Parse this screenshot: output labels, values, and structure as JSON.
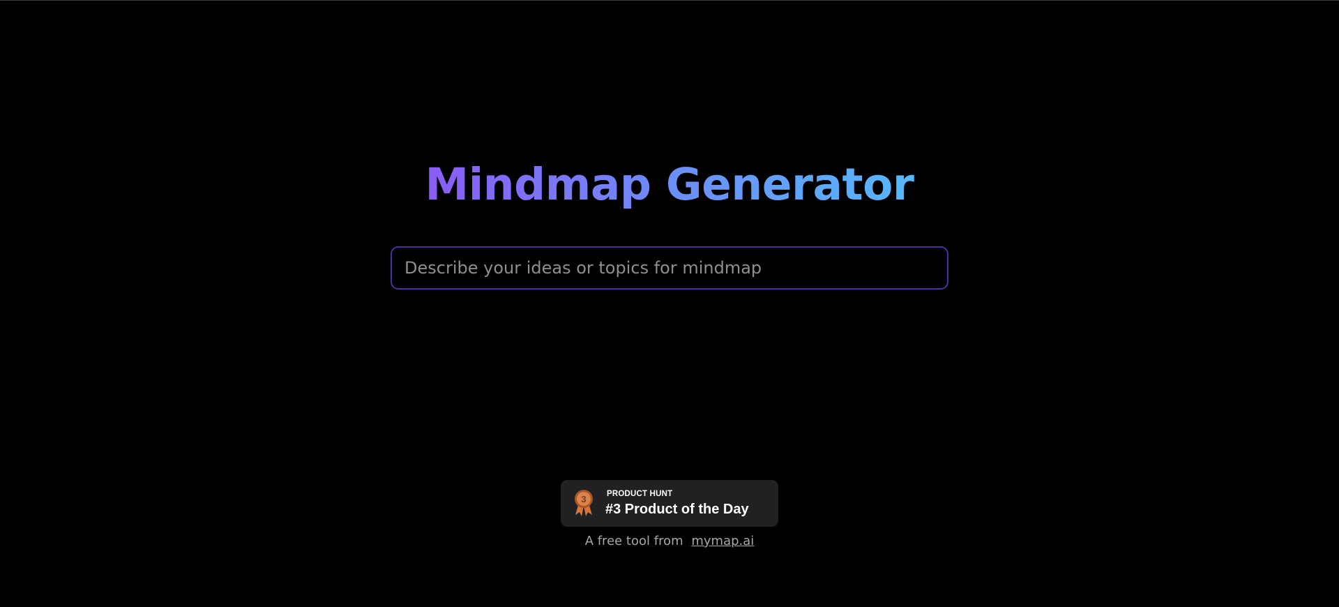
{
  "hero": {
    "title": "Mindmap Generator"
  },
  "search": {
    "value": "",
    "placeholder": "Describe your ideas or topics for mindmap"
  },
  "badge": {
    "label": "PRODUCT HUNT",
    "title": "#3 Product of the Day",
    "rank": "3",
    "icon": "medal-icon"
  },
  "footer": {
    "text": "A free tool from",
    "link_text": "mymap.ai"
  },
  "colors": {
    "background": "#000000",
    "title_gradient_start": "#8b5cf6",
    "title_gradient_end": "#57b8fb",
    "input_border": "#4c2d9c",
    "badge_background": "#212022",
    "medal": "#c8703a",
    "muted_text": "#a6a6a6"
  }
}
